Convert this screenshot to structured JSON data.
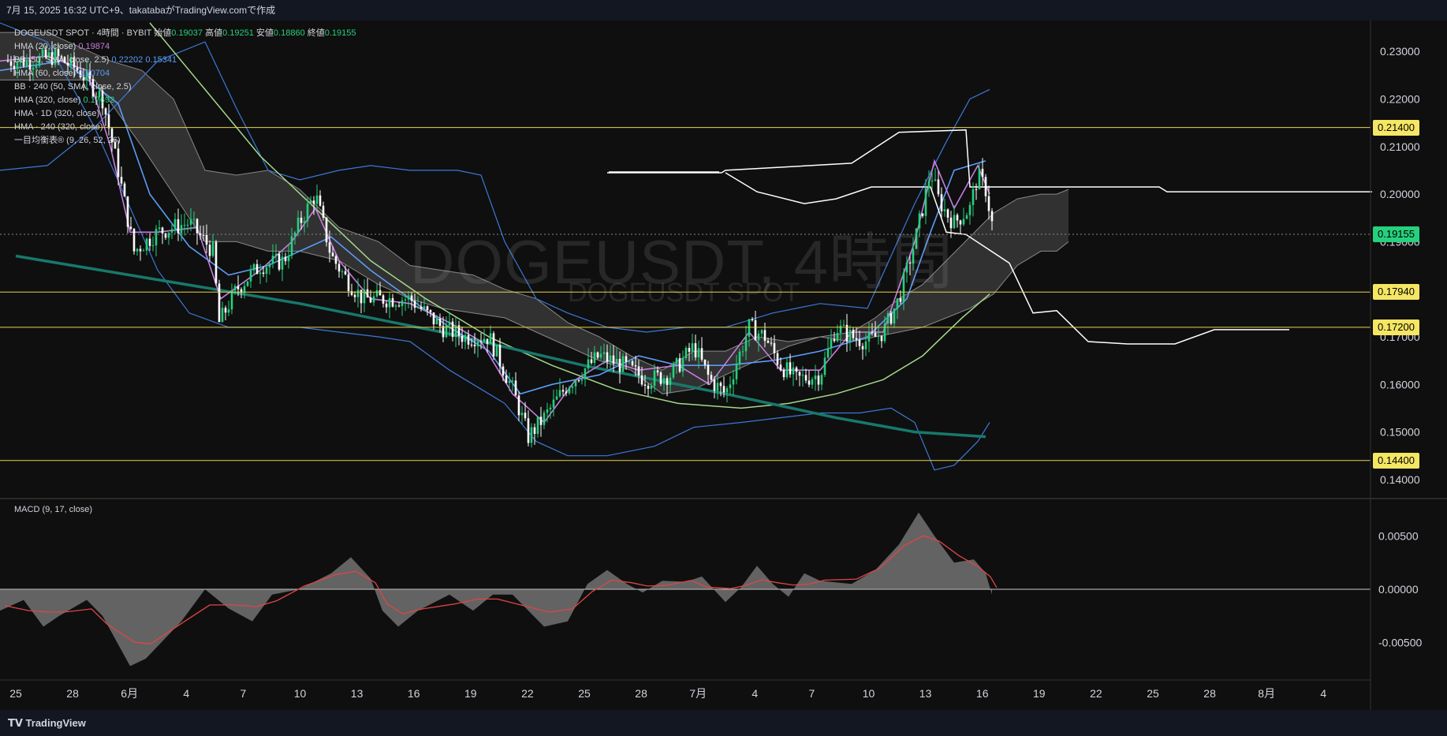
{
  "header": {
    "text": "7月 15, 2025 16:32 UTC+9、takatabaがTradingView.comで作成"
  },
  "legend": {
    "symbol": "DOGEUSDT SPOT · 4時間 · BYBIT",
    "open_label": "始値",
    "open": "0.19037",
    "high_label": "高値",
    "high": "0.19251",
    "low_label": "安値",
    "low": "0.18860",
    "close_label": "終値",
    "close": "0.19155",
    "hma20": "HMA (20, close)",
    "hma20_val": "0.19874",
    "bb50": "BB (50, SMA, close, 2.5)",
    "bb50_upper": "0.22202",
    "bb50_lower": "0.15341",
    "hma60": "HMA (60, close)",
    "hma60_val": "0.20704",
    "bb240": "BB · 240 (50, SMA, close, 2.5)",
    "hma320": "HMA (320, close)",
    "hma320_val": "0.17692",
    "hma1d": "HMA · 1D (320, close)",
    "hma240": "HMA · 240 (320, close)",
    "ichimoku": "一目均衡表® (9, 26, 52, 26)"
  },
  "macd_label": "MACD (9, 17, close)",
  "watermark": {
    "main": "DOGEUSDT, 4時間",
    "sub": "DOGEUSDT SPOT"
  },
  "footer": {
    "brand": "TradingView"
  },
  "colors": {
    "up": "#26d07c",
    "down": "#ffffff",
    "hline": "#e8d44d",
    "current": "#26d07c",
    "hma20": "#c67ce0",
    "hma60": "#5b9cf6",
    "bb": "#3b78d8",
    "green_ma": "#a5d88a",
    "teal_ma": "#18786b"
  },
  "chart_data": {
    "type": "candlestick",
    "y_ticks": [
      "0.23000",
      "0.22000",
      "0.21000",
      "0.20000",
      "0.19000",
      "0.18000",
      "0.17000",
      "0.16000",
      "0.15000",
      "0.14000"
    ],
    "ylim": [
      0.136,
      0.2365
    ],
    "x_ticks": [
      "25",
      "28",
      "6月",
      "4",
      "7",
      "10",
      "13",
      "16",
      "19",
      "22",
      "25",
      "28",
      "7月",
      "4",
      "7",
      "10",
      "13",
      "16",
      "19",
      "22",
      "25",
      "28",
      "8月",
      "4"
    ],
    "horizontal_levels": [
      "0.21400",
      "0.17940",
      "0.17200",
      "0.14400"
    ],
    "current_price": "0.19155",
    "price_path": [
      [
        0,
        0.228
      ],
      [
        40,
        0.228
      ],
      [
        70,
        0.229
      ],
      [
        100,
        0.226
      ],
      [
        130,
        0.22
      ],
      [
        150,
        0.205
      ],
      [
        170,
        0.188
      ],
      [
        200,
        0.192
      ],
      [
        240,
        0.194
      ],
      [
        270,
        0.188
      ],
      [
        278,
        0.173
      ],
      [
        300,
        0.18
      ],
      [
        330,
        0.185
      ],
      [
        360,
        0.186
      ],
      [
        380,
        0.194
      ],
      [
        400,
        0.2
      ],
      [
        420,
        0.187
      ],
      [
        440,
        0.182
      ],
      [
        460,
        0.178
      ],
      [
        490,
        0.178
      ],
      [
        520,
        0.178
      ],
      [
        560,
        0.172
      ],
      [
        590,
        0.17
      ],
      [
        620,
        0.17
      ],
      [
        650,
        0.159
      ],
      [
        670,
        0.149
      ],
      [
        690,
        0.153
      ],
      [
        720,
        0.16
      ],
      [
        760,
        0.166
      ],
      [
        790,
        0.164
      ],
      [
        820,
        0.161
      ],
      [
        850,
        0.162
      ],
      [
        880,
        0.168
      ],
      [
        900,
        0.161
      ],
      [
        920,
        0.158
      ],
      [
        950,
        0.172
      ],
      [
        970,
        0.17
      ],
      [
        990,
        0.164
      ],
      [
        1010,
        0.161
      ],
      [
        1040,
        0.162
      ],
      [
        1060,
        0.172
      ],
      [
        1080,
        0.17
      ],
      [
        1100,
        0.169
      ],
      [
        1120,
        0.171
      ],
      [
        1140,
        0.178
      ],
      [
        1160,
        0.19
      ],
      [
        1170,
        0.197
      ],
      [
        1180,
        0.205
      ],
      [
        1190,
        0.199
      ],
      [
        1200,
        0.196
      ],
      [
        1210,
        0.194
      ],
      [
        1230,
        0.197
      ],
      [
        1240,
        0.204
      ],
      [
        1250,
        0.201
      ],
      [
        1260,
        0.192
      ]
    ],
    "macd_ticks": [
      "0.00500",
      "0.00000",
      "-0.00500"
    ],
    "macd_ylim": [
      -0.0085,
      0.0085
    ],
    "macd_path": [
      [
        0,
        -0.002
      ],
      [
        30,
        -0.001
      ],
      [
        55,
        -0.0035
      ],
      [
        75,
        -0.0025
      ],
      [
        110,
        -0.001
      ],
      [
        130,
        -0.0025
      ],
      [
        165,
        -0.0072
      ],
      [
        185,
        -0.0065
      ],
      [
        230,
        -0.003
      ],
      [
        260,
        0
      ],
      [
        290,
        -0.0018
      ],
      [
        320,
        -0.003
      ],
      [
        345,
        -0.0005
      ],
      [
        380,
        0
      ],
      [
        420,
        0.0015
      ],
      [
        445,
        0.003
      ],
      [
        470,
        0.001
      ],
      [
        485,
        -0.002
      ],
      [
        505,
        -0.0035
      ],
      [
        530,
        -0.002
      ],
      [
        570,
        -0.0005
      ],
      [
        600,
        -0.002
      ],
      [
        625,
        -0.0005
      ],
      [
        650,
        -0.0005
      ],
      [
        690,
        -0.0035
      ],
      [
        720,
        -0.003
      ],
      [
        745,
        0.0005
      ],
      [
        770,
        0.0018
      ],
      [
        795,
        0.0005
      ],
      [
        815,
        -0.0003
      ],
      [
        840,
        0.0008
      ],
      [
        870,
        0.0007
      ],
      [
        890,
        0.0012
      ],
      [
        920,
        -0.0012
      ],
      [
        940,
        0.0002
      ],
      [
        960,
        0.0022
      ],
      [
        980,
        0.0005
      ],
      [
        1000,
        -0.0007
      ],
      [
        1020,
        0.0015
      ],
      [
        1040,
        0.0008
      ],
      [
        1080,
        0.0005
      ],
      [
        1110,
        0.0018
      ],
      [
        1140,
        0.0042
      ],
      [
        1165,
        0.0072
      ],
      [
        1185,
        0.005
      ],
      [
        1210,
        0.0025
      ],
      [
        1235,
        0.0028
      ],
      [
        1250,
        0.0015
      ],
      [
        1258,
        -0.0005
      ]
    ],
    "overlays": {
      "hma20": [
        [
          0,
          0.228
        ],
        [
          60,
          0.229
        ],
        [
          110,
          0.226
        ],
        [
          140,
          0.21
        ],
        [
          165,
          0.192
        ],
        [
          200,
          0.192
        ],
        [
          250,
          0.193
        ],
        [
          280,
          0.178
        ],
        [
          330,
          0.184
        ],
        [
          370,
          0.19
        ],
        [
          400,
          0.197
        ],
        [
          430,
          0.186
        ],
        [
          470,
          0.178
        ],
        [
          520,
          0.177
        ],
        [
          570,
          0.173
        ],
        [
          610,
          0.169
        ],
        [
          650,
          0.158
        ],
        [
          690,
          0.152
        ],
        [
          730,
          0.161
        ],
        [
          770,
          0.165
        ],
        [
          810,
          0.163
        ],
        [
          860,
          0.164
        ],
        [
          900,
          0.16
        ],
        [
          950,
          0.171
        ],
        [
          990,
          0.163
        ],
        [
          1040,
          0.163
        ],
        [
          1080,
          0.171
        ],
        [
          1120,
          0.171
        ],
        [
          1160,
          0.19
        ],
        [
          1185,
          0.207
        ],
        [
          1210,
          0.197
        ],
        [
          1240,
          0.206
        ],
        [
          1255,
          0.2
        ]
      ],
      "hma60": [
        [
          0,
          0.226
        ],
        [
          80,
          0.228
        ],
        [
          150,
          0.219
        ],
        [
          190,
          0.2
        ],
        [
          240,
          0.189
        ],
        [
          290,
          0.183
        ],
        [
          340,
          0.185
        ],
        [
          380,
          0.188
        ],
        [
          420,
          0.191
        ],
        [
          470,
          0.184
        ],
        [
          520,
          0.178
        ],
        [
          570,
          0.172
        ],
        [
          620,
          0.167
        ],
        [
          660,
          0.158
        ],
        [
          700,
          0.16
        ],
        [
          760,
          0.162
        ],
        [
          810,
          0.166
        ],
        [
          860,
          0.164
        ],
        [
          920,
          0.164
        ],
        [
          980,
          0.165
        ],
        [
          1040,
          0.167
        ],
        [
          1100,
          0.17
        ],
        [
          1150,
          0.178
        ],
        [
          1180,
          0.192
        ],
        [
          1210,
          0.205
        ],
        [
          1250,
          0.207
        ]
      ],
      "bb_upper": [
        [
          0,
          0.205
        ],
        [
          60,
          0.206
        ],
        [
          120,
          0.214
        ],
        [
          200,
          0.228
        ],
        [
          260,
          0.232
        ],
        [
          300,
          0.218
        ],
        [
          340,
          0.205
        ],
        [
          380,
          0.203
        ],
        [
          430,
          0.205
        ],
        [
          470,
          0.206
        ],
        [
          520,
          0.205
        ],
        [
          580,
          0.205
        ],
        [
          610,
          0.204
        ],
        [
          640,
          0.19
        ],
        [
          680,
          0.178
        ],
        [
          720,
          0.175
        ],
        [
          770,
          0.172
        ],
        [
          820,
          0.171
        ],
        [
          870,
          0.172
        ],
        [
          920,
          0.172
        ],
        [
          980,
          0.175
        ],
        [
          1040,
          0.177
        ],
        [
          1100,
          0.176
        ],
        [
          1160,
          0.198
        ],
        [
          1200,
          0.211
        ],
        [
          1230,
          0.22
        ],
        [
          1255,
          0.222
        ]
      ],
      "bb_lower": [
        [
          0,
          0.236
        ],
        [
          60,
          0.232
        ],
        [
          120,
          0.214
        ],
        [
          160,
          0.199
        ],
        [
          200,
          0.184
        ],
        [
          240,
          0.175
        ],
        [
          290,
          0.172
        ],
        [
          330,
          0.172
        ],
        [
          380,
          0.172
        ],
        [
          430,
          0.171
        ],
        [
          480,
          0.17
        ],
        [
          520,
          0.169
        ],
        [
          570,
          0.163
        ],
        [
          610,
          0.159
        ],
        [
          640,
          0.156
        ],
        [
          680,
          0.148
        ],
        [
          720,
          0.145
        ],
        [
          770,
          0.145
        ],
        [
          830,
          0.147
        ],
        [
          880,
          0.151
        ],
        [
          940,
          0.152
        ],
        [
          990,
          0.153
        ],
        [
          1040,
          0.154
        ],
        [
          1090,
          0.154
        ],
        [
          1130,
          0.155
        ],
        [
          1160,
          0.152
        ],
        [
          1185,
          0.142
        ],
        [
          1210,
          0.143
        ],
        [
          1240,
          0.148
        ],
        [
          1255,
          0.152
        ]
      ]
    },
    "ichimoku": {
      "cloud_top": [
        [
          0,
          0.234
        ],
        [
          60,
          0.234
        ],
        [
          140,
          0.228
        ],
        [
          180,
          0.226
        ],
        [
          220,
          0.22
        ],
        [
          260,
          0.205
        ],
        [
          300,
          0.204
        ],
        [
          340,
          0.205
        ],
        [
          380,
          0.201
        ],
        [
          430,
          0.193
        ],
        [
          480,
          0.19
        ],
        [
          520,
          0.185
        ],
        [
          560,
          0.184
        ],
        [
          600,
          0.183
        ],
        [
          640,
          0.18
        ],
        [
          680,
          0.178
        ],
        [
          720,
          0.173
        ],
        [
          760,
          0.17
        ],
        [
          800,
          0.166
        ],
        [
          840,
          0.163
        ],
        [
          880,
          0.167
        ],
        [
          920,
          0.167
        ],
        [
          960,
          0.17
        ],
        [
          1000,
          0.169
        ],
        [
          1040,
          0.17
        ],
        [
          1080,
          0.171
        ],
        [
          1110,
          0.174
        ],
        [
          1140,
          0.178
        ],
        [
          1170,
          0.181
        ],
        [
          1200,
          0.186
        ],
        [
          1230,
          0.191
        ],
        [
          1260,
          0.196
        ],
        [
          1290,
          0.199
        ],
        [
          1320,
          0.2
        ],
        [
          1340,
          0.2
        ],
        [
          1355,
          0.201
        ]
      ],
      "cloud_bottom": [
        [
          0,
          0.224
        ],
        [
          60,
          0.224
        ],
        [
          120,
          0.224
        ],
        [
          180,
          0.21
        ],
        [
          220,
          0.2
        ],
        [
          260,
          0.19
        ],
        [
          300,
          0.19
        ],
        [
          340,
          0.188
        ],
        [
          380,
          0.188
        ],
        [
          430,
          0.186
        ],
        [
          480,
          0.181
        ],
        [
          520,
          0.178
        ],
        [
          560,
          0.176
        ],
        [
          600,
          0.175
        ],
        [
          640,
          0.174
        ],
        [
          680,
          0.171
        ],
        [
          720,
          0.168
        ],
        [
          760,
          0.165
        ],
        [
          800,
          0.163
        ],
        [
          840,
          0.158
        ],
        [
          880,
          0.159
        ],
        [
          920,
          0.162
        ],
        [
          960,
          0.165
        ],
        [
          1000,
          0.168
        ],
        [
          1040,
          0.17
        ],
        [
          1080,
          0.169
        ],
        [
          1110,
          0.17
        ],
        [
          1140,
          0.171
        ],
        [
          1170,
          0.172
        ],
        [
          1200,
          0.174
        ],
        [
          1230,
          0.176
        ],
        [
          1260,
          0.179
        ],
        [
          1290,
          0.185
        ],
        [
          1320,
          0.188
        ],
        [
          1340,
          0.188
        ],
        [
          1355,
          0.19
        ]
      ],
      "span_white": [
        [
          770,
          0.2045
        ],
        [
          915,
          0.2045
        ],
        [
          920,
          0.205
        ],
        [
          1080,
          0.2065
        ],
        [
          1140,
          0.213
        ],
        [
          1225,
          0.2135
        ],
        [
          1230,
          0.2015
        ],
        [
          1470,
          0.2015
        ],
        [
          1480,
          0.2005
        ],
        [
          1740,
          0.2005
        ]
      ],
      "span_white2": [
        [
          920,
          0.2045
        ],
        [
          960,
          0.2005
        ],
        [
          1020,
          0.198
        ],
        [
          1060,
          0.199
        ],
        [
          1105,
          0.2015
        ],
        [
          1180,
          0.2015
        ],
        [
          1200,
          0.192
        ],
        [
          1225,
          0.1915
        ],
        [
          1280,
          0.1855
        ],
        [
          1310,
          0.175
        ],
        [
          1340,
          0.1755
        ],
        [
          1380,
          0.169
        ],
        [
          1430,
          0.1685
        ],
        [
          1490,
          0.1685
        ],
        [
          1540,
          0.1715
        ],
        [
          1635,
          0.1715
        ]
      ]
    }
  }
}
